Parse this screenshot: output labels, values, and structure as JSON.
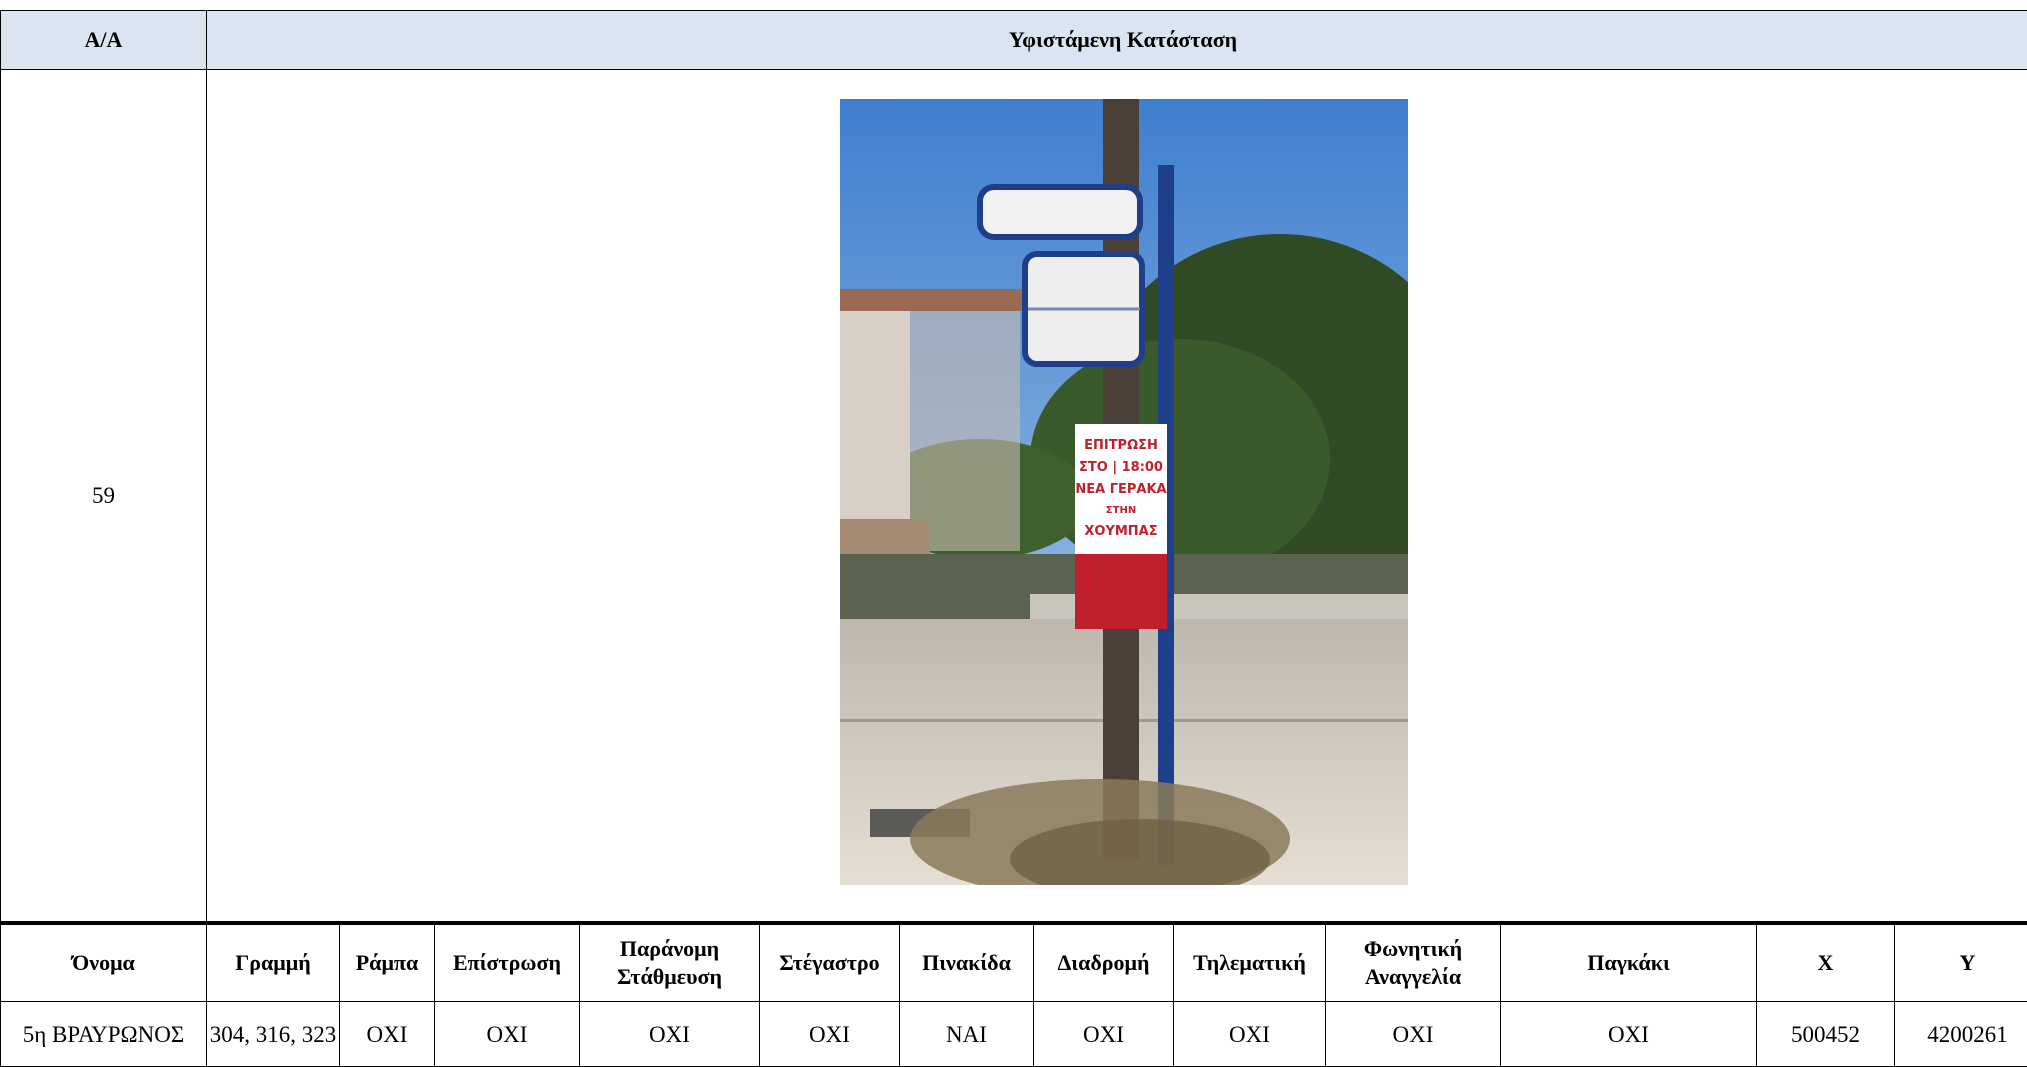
{
  "top": {
    "col_aa": "A/A",
    "col_status": "Υφιστάμενη Κατάσταση",
    "row_number": "59"
  },
  "photo": {
    "sign_text": [
      "ΕΠΙΤΡΩΣΗ",
      "ΣΤΟ | 18:00",
      "ΝΕΑ ΓΕΡΑΚΑ",
      "ΣΤΗΝ",
      "ΧΟΥΜΠΑΣ"
    ]
  },
  "details": {
    "headers": [
      "Όνομα",
      "Γραμμή",
      "Ράμπα",
      "Επίστρωση",
      "Παράνομη Στάθμευση",
      "Στέγαστρο",
      "Πινακίδα",
      "Διαδρομή",
      "Τηλεματική",
      "Φωνητική Αναγγελία",
      "Παγκάκι",
      "X",
      "Y"
    ],
    "row": [
      "5η ΒΡΑΥΡΩΝΟΣ",
      "304, 316, 323",
      "ΟΧΙ",
      "ΟΧΙ",
      "ΟΧΙ",
      "ΟΧΙ",
      "ΝΑΙ",
      "ΟΧΙ",
      "ΟΧΙ",
      "ΟΧΙ",
      "ΟΧΙ",
      "500452",
      "4200261"
    ]
  }
}
